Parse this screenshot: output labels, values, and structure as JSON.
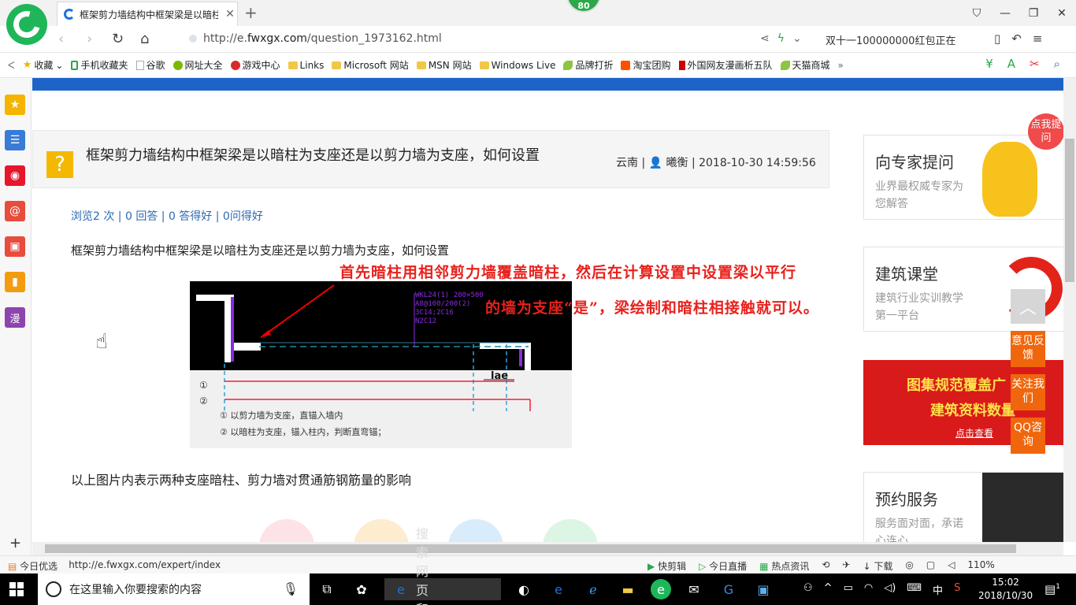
{
  "browser": {
    "tab_title": "框架剪力墙结构中框架梁是以暗柱",
    "badge": "80",
    "url_prefix": "http://e.",
    "url_domain": "fwxgx.com",
    "url_path": "/question_1973162.html",
    "search_text": "双十一100000000红包正在",
    "window_controls": [
      "shirt-icon",
      "minimize-icon",
      "restore-icon",
      "close-icon"
    ]
  },
  "bookmarks": [
    {
      "label": "收藏",
      "icon": "star-icon"
    },
    {
      "label": "手机收藏夹",
      "icon": "phone-icon"
    },
    {
      "label": "谷歌",
      "icon": "page-icon"
    },
    {
      "label": "网址大全",
      "icon": "globe-icon"
    },
    {
      "label": "游戏中心",
      "icon": "game-icon"
    },
    {
      "label": "Links",
      "icon": "folder-icon"
    },
    {
      "label": "Microsoft 网站",
      "icon": "folder-icon"
    },
    {
      "label": "MSN 网站",
      "icon": "folder-icon"
    },
    {
      "label": "Windows Live",
      "icon": "folder-icon"
    },
    {
      "label": "品牌打折",
      "icon": "leaf-icon"
    },
    {
      "label": "淘宝团购",
      "icon": "taobao-icon"
    },
    {
      "label": "外国网友漫画析五队",
      "icon": "bookmark-icon"
    },
    {
      "label": "天猫商城",
      "icon": "leaf-icon"
    }
  ],
  "sidebar": [
    {
      "name": "favorites-icon",
      "color": "#f5b400",
      "glyph": "★"
    },
    {
      "name": "reader-icon",
      "color": "#3a7bd5",
      "glyph": "☰"
    },
    {
      "name": "weibo-icon",
      "color": "#e6162d",
      "glyph": "◉"
    },
    {
      "name": "mail-icon",
      "color": "#e74c3c",
      "glyph": "@"
    },
    {
      "name": "game-icon",
      "color": "#e74c3c",
      "glyph": "▣"
    },
    {
      "name": "novel-icon",
      "color": "#f39c12",
      "glyph": "▮"
    },
    {
      "name": "comic-icon",
      "color": "#8e44ad",
      "glyph": "漫"
    }
  ],
  "question": {
    "title": "框架剪力墙结构中框架梁是以暗柱为支座还是以剪力墙为支座，如何设置",
    "meta": "云南 | 👤 曦衡 | 2018-10-30 14:59:56",
    "stats": "浏览2 次 | 0 回答 | 0 答得好 | 0问得好",
    "body": "框架剪力墙结构中框架梁是以暗柱为支座还是以剪力墙为支座，如何设置",
    "footer": "以上图片内表示两种支座暗柱、剪力墙对贯通筋钢筋量的影响",
    "figure": {
      "beam_label": [
        "WKL24(1) 200×500",
        "A8@100/200(2)",
        "3C14;2C16",
        "N2C12"
      ],
      "lae": "lae",
      "row1": "①",
      "row2": "②",
      "note1": "① 以剪力墙为支座，直锚入墙内",
      "note2": "② 以暗柱为支座，锚入柱内，判断直弯锚；"
    }
  },
  "annotation": {
    "line1": "首先暗柱用相邻剪力墙覆盖暗柱，然后在计算设置中设置梁以平行",
    "line2": "的墙为支座“是”，梁绘制和暗柱相接触就可以。"
  },
  "right_cards": {
    "expert": {
      "title": "向专家提问",
      "subtitle": "业界最权威专家为您解答",
      "bubble": "点我提问"
    },
    "classroom": {
      "title": "建筑课堂",
      "subtitle": "建筑行业实训教学第一平台"
    },
    "ad": {
      "line1": "图集规范覆盖广",
      "line2": "建筑资料数量",
      "link": "点击查看"
    },
    "booking": {
      "title": "预约服务",
      "subtitle": "服务面对面，承诺心连心"
    }
  },
  "float_buttons": [
    "意见反馈",
    "关注我们",
    "QQ咨询"
  ],
  "statusbar": {
    "left_label": "今日优选",
    "url": "http://e.fwxgx.com/expert/index",
    "items": [
      "快剪辑",
      "今日直播",
      "热点资讯",
      "下载"
    ],
    "zoom": "110%"
  },
  "taskbar": {
    "search_placeholder": "在这里输入你要搜索的内容",
    "browser_search": "搜索网页和文件",
    "ime": "中",
    "time": "15:02",
    "date": "2018/10/30",
    "notification_count": "1"
  }
}
